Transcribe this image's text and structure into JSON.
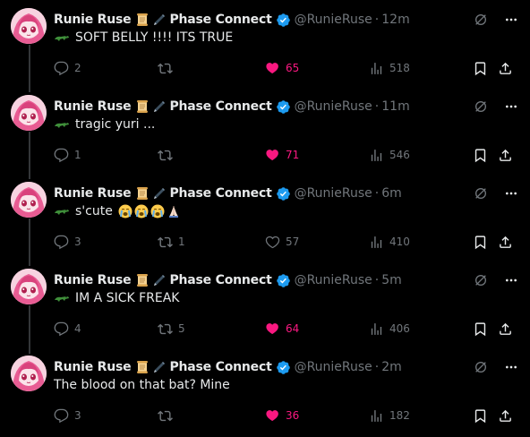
{
  "author": {
    "name": "Runie Ruse",
    "affiliation": "Phase Connect",
    "handle": "@RunieRuse"
  },
  "colors": {
    "background": "#000000",
    "text": "#e7e9ea",
    "muted": "#71767b",
    "like_active": "#f91880",
    "verified": "#1d9bf0"
  },
  "icons": {
    "reply": "reply-icon",
    "retweet": "retweet-icon",
    "like": "heart-icon",
    "views": "views-icon",
    "bookmark": "bookmark-icon",
    "share": "share-icon",
    "grok": "grok-icon",
    "more": "more-icon"
  },
  "tweets": [
    {
      "time": "12m",
      "text": "SOFT BELLY !!!! ITS TRUE",
      "replies": "2",
      "retweets": "",
      "likes": "65",
      "liked": true,
      "views": "518"
    },
    {
      "time": "11m",
      "text": "tragic yuri ...",
      "replies": "1",
      "retweets": "",
      "likes": "71",
      "liked": true,
      "views": "546"
    },
    {
      "time": "6m",
      "text": "s'cute",
      "replies": "3",
      "retweets": "1",
      "likes": "57",
      "liked": false,
      "views": "410"
    },
    {
      "time": "5m",
      "text": "IM A SICK FREAK",
      "replies": "4",
      "retweets": "5",
      "likes": "64",
      "liked": true,
      "views": "406"
    },
    {
      "time": "2m",
      "text": "The blood on that bat? Mine",
      "replies": "3",
      "retweets": "",
      "likes": "36",
      "liked": true,
      "views": "182"
    }
  ]
}
